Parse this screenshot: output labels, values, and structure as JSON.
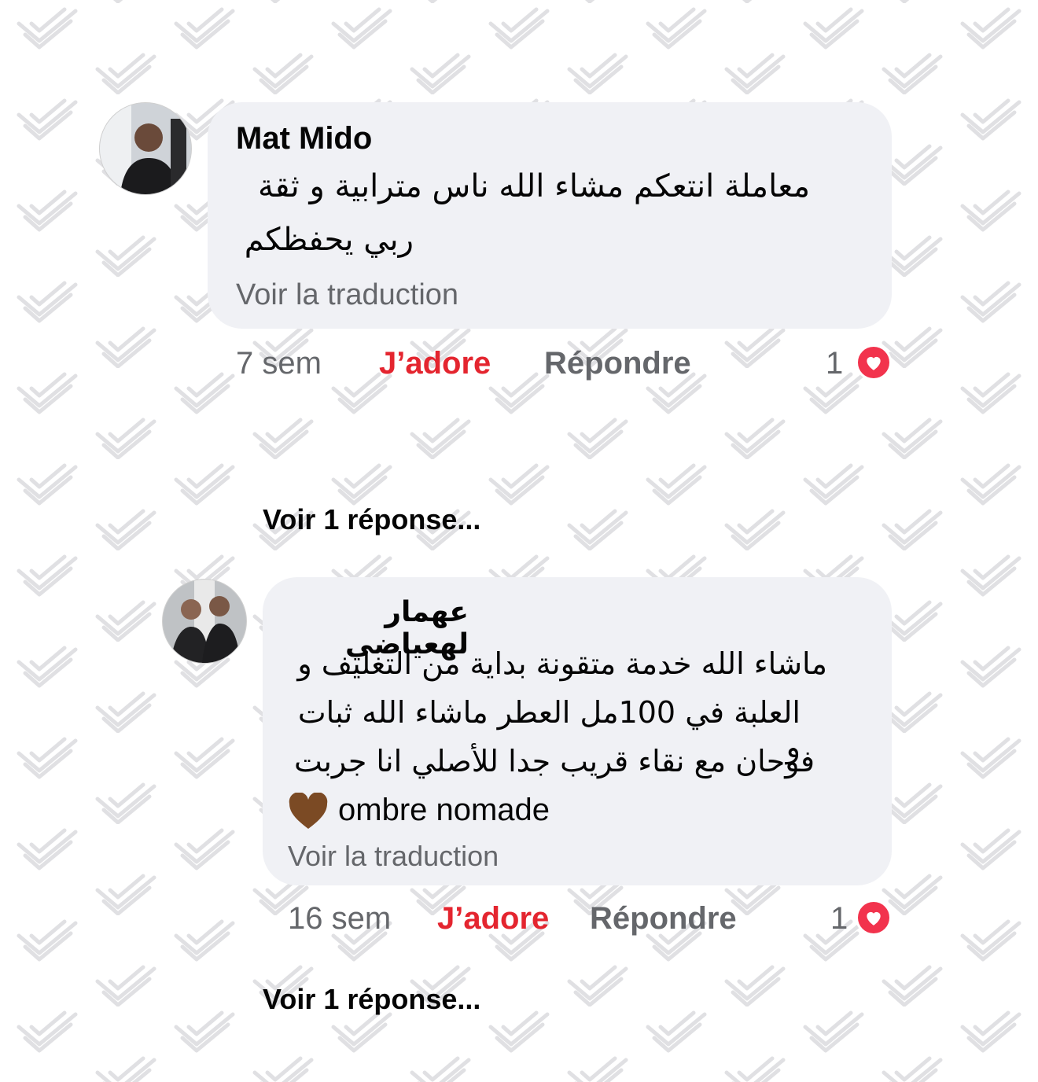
{
  "comments": [
    {
      "author": "Mat Mido",
      "text_lines": [
        "معاملة انتعكم مشاء الله ناس مترابية و ثقة",
        "ربي يحفظكم"
      ],
      "see_translation": "Voir la traduction",
      "time": "7 sem",
      "like_label": "J’adore",
      "reply_label": "Répondre",
      "reaction_count": "1",
      "reaction_icon": "heart-icon",
      "see_replies": "Voir 1 réponse..."
    },
    {
      "author": "عهمار لهعياضي",
      "text_lines": [
        "ماشاء الله خدمة متقونة بداية من التغليف و",
        "العلبة في 100مل العطر ماشاء الله ثبات و",
        "فوحان مع نقاء قريب جدا للأصلي انا جربت"
      ],
      "last_line_emoji": "brown-heart-icon",
      "last_line_text": "ombre nomade",
      "see_translation": "Voir la traduction",
      "time": "16 sem",
      "like_label": "J’adore",
      "reply_label": "Répondre",
      "reaction_count": "1",
      "reaction_icon": "heart-icon",
      "see_replies": "Voir 1 réponse..."
    }
  ],
  "colors": {
    "bubble": "#f0f1f5",
    "like_active": "#e4252f",
    "muted": "#65676b",
    "reaction_heart": "#f2334d",
    "emoji_heart": "#7b4a24"
  }
}
